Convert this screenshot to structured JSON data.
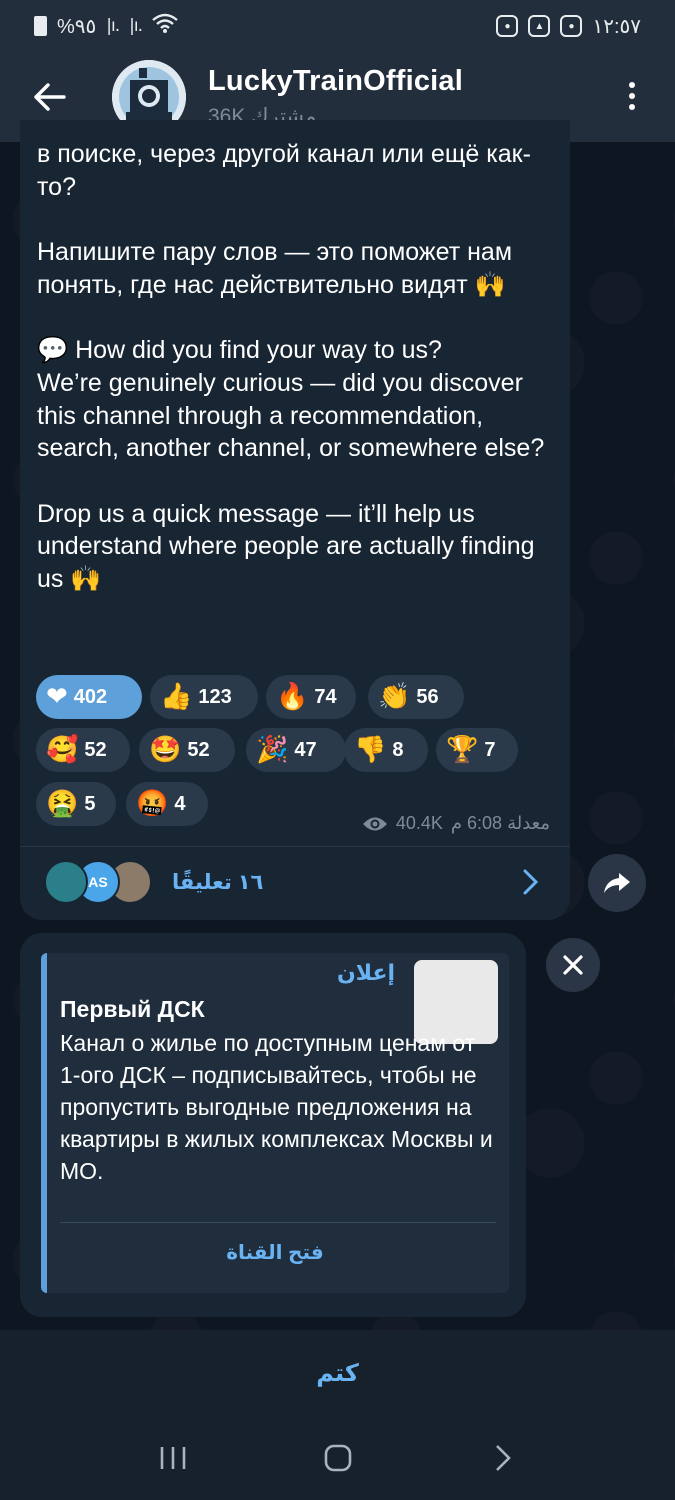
{
  "status_bar": {
    "battery": "%٩٥",
    "time": "١٢:٥٧"
  },
  "header": {
    "channel_name": "LuckyTrainOfficial",
    "subscribers": "36K مشترك"
  },
  "message": {
    "text": "в поиске, через другой канал или ещё как-то?\n\nНапишите пару слов — это поможет нам понять, где нас действительно видят 🙌\n\n💬 How did you find your way to us?\nWe’re genuinely curious — did you discover this channel through a recommendation, search, another channel, or somewhere else?\n\nDrop us a quick message — it’ll help us understand where people are actually finding us 🙌",
    "reactions": [
      {
        "emoji": "❤",
        "count": "402",
        "active": true
      },
      {
        "emoji": "👍",
        "count": "123",
        "active": false
      },
      {
        "emoji": "🔥",
        "count": "74",
        "active": false
      },
      {
        "emoji": "👏",
        "count": "56",
        "active": false
      },
      {
        "emoji": "🥰",
        "count": "52",
        "active": false
      },
      {
        "emoji": "🤩",
        "count": "52",
        "active": false
      },
      {
        "emoji": "🎉",
        "count": "47",
        "active": false
      },
      {
        "emoji": "👎",
        "count": "8",
        "active": false
      },
      {
        "emoji": "🏆",
        "count": "7",
        "active": false
      },
      {
        "emoji": "🤮",
        "count": "5",
        "active": false
      },
      {
        "emoji": "🤬",
        "count": "4",
        "active": false
      }
    ],
    "views": "40.4K",
    "edited_time": "معدلة 6:08 م",
    "comments_label": "١٦ تعليقًا",
    "comment_avatar_initials": "AS"
  },
  "ad": {
    "tag": "إعلان",
    "title": "Первый ДСК",
    "text": "Канал о жилье по доступным ценам от 1-ого ДСК – подписывайтесь, чтобы не пропустить выгодные предложения на квартиры в жилых комплексах Москвы и МО.",
    "open_button": "فتح القناة"
  },
  "bottom": {
    "mute_label": "كتم"
  },
  "colors": {
    "accent": "#6ab3f3",
    "active_reaction": "#5ea0d9",
    "bubble": "#182533",
    "header": "#232e3c"
  }
}
